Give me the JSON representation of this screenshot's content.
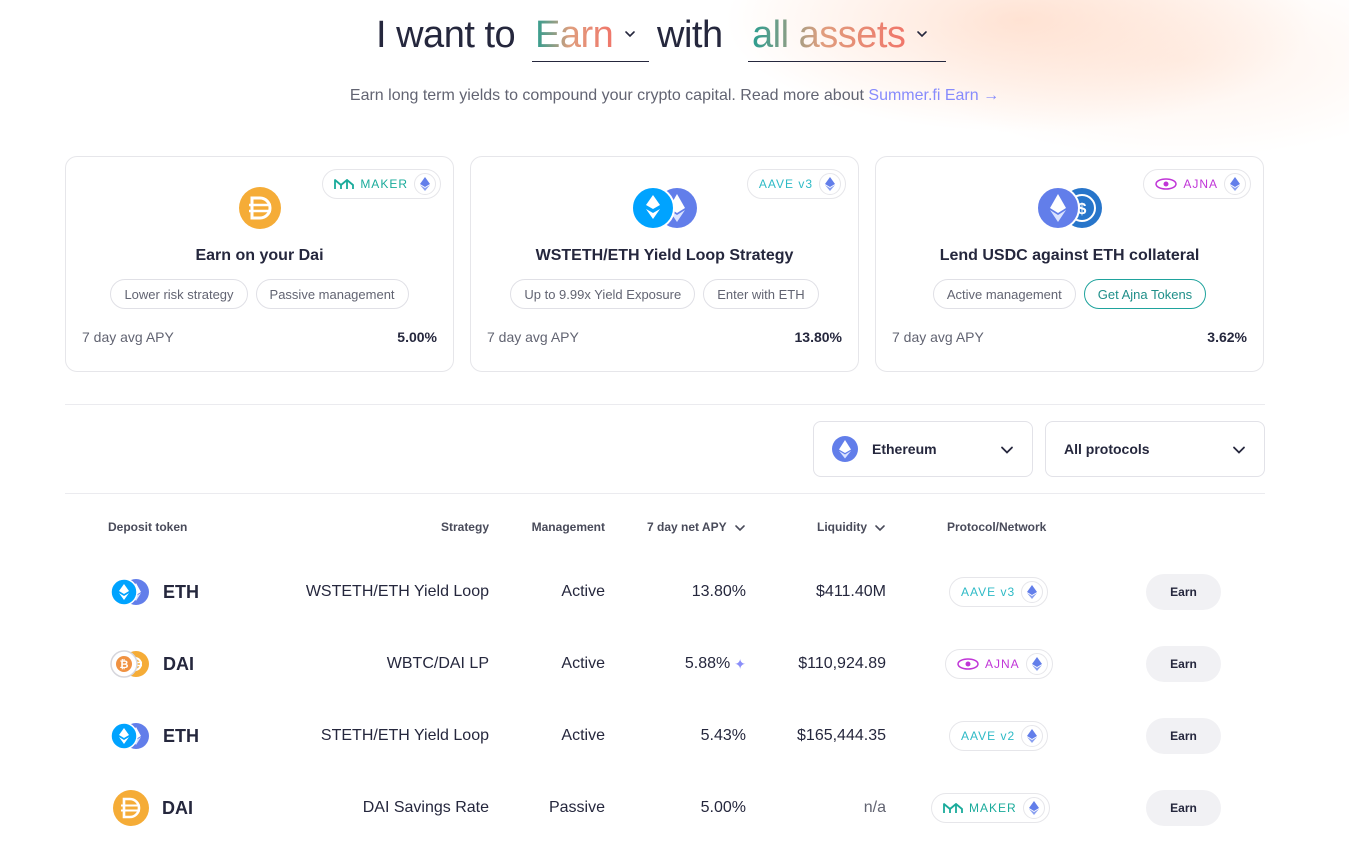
{
  "hero": {
    "prefix": "I want to",
    "product": "Earn",
    "middle": "with",
    "asset": "all assets",
    "subtitle": "Earn long term yields to compound your crypto capital. Read more about",
    "link": "Summer.fi Earn",
    "link_arrow": "→"
  },
  "cards": [
    {
      "protocol": "MAKER",
      "title": "Earn on your Dai",
      "tags": [
        "Lower risk strategy",
        "Passive management"
      ],
      "apy_label": "7 day avg APY",
      "apy": "5.00%"
    },
    {
      "protocol": "AAVE v3",
      "title": "WSTETH/ETH Yield Loop Strategy",
      "tags": [
        "Up to 9.99x Yield Exposure",
        "Enter with ETH"
      ],
      "apy_label": "7 day avg APY",
      "apy": "13.80%"
    },
    {
      "protocol": "AJNA",
      "title": "Lend USDC against ETH collateral",
      "tags": [
        "Active management",
        "Get Ajna Tokens"
      ],
      "apy_label": "7 day avg APY",
      "apy": "3.62%"
    }
  ],
  "filters": {
    "network": "Ethereum",
    "protocols": "All protocols"
  },
  "table": {
    "headers": {
      "deposit_token": "Deposit token",
      "strategy": "Strategy",
      "management": "Management",
      "apy": "7 day net APY",
      "liquidity": "Liquidity",
      "protocol": "Protocol/Network"
    },
    "rows": [
      {
        "token": "ETH",
        "strategy": "WSTETH/ETH Yield Loop",
        "management": "Active",
        "apy": "13.80%",
        "liquidity": "$411.40M",
        "protocol": "AAVE v3",
        "action": "Earn"
      },
      {
        "token": "DAI",
        "strategy": "WBTC/DAI LP",
        "management": "Active",
        "apy": "5.88%",
        "liquidity": "$110,924.89",
        "protocol": "AJNA",
        "action": "Earn"
      },
      {
        "token": "ETH",
        "strategy": "STETH/ETH Yield Loop",
        "management": "Active",
        "apy": "5.43%",
        "liquidity": "$165,444.35",
        "protocol": "AAVE v2",
        "action": "Earn"
      },
      {
        "token": "DAI",
        "strategy": "DAI Savings Rate",
        "management": "Passive",
        "apy": "5.00%",
        "liquidity": "n/a",
        "protocol": "MAKER",
        "action": "Earn"
      }
    ]
  },
  "colors": {
    "maker": "#1aab9b",
    "aave": "#2ebac6",
    "aave_accent": "#b6509e",
    "ajna": "#c035d7",
    "dai": "#f5ac37",
    "eth": "#627eea",
    "link": "#878bfc"
  }
}
